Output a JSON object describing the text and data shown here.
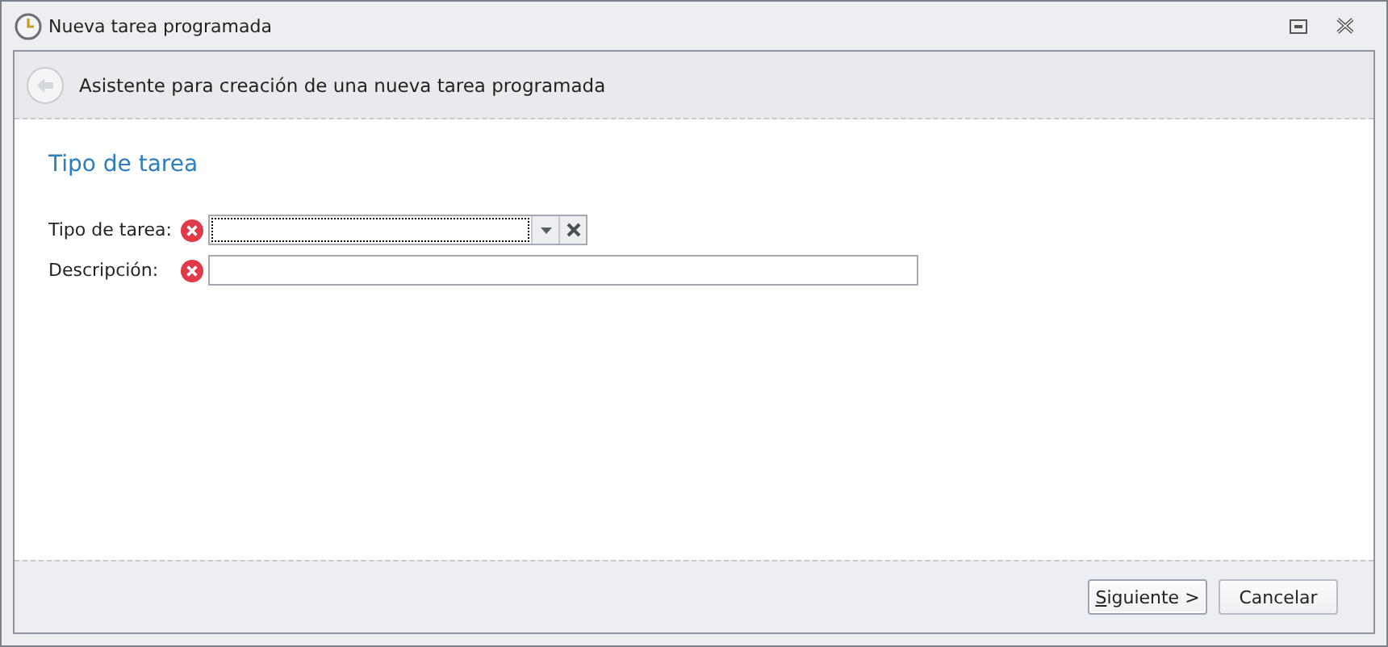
{
  "window": {
    "title": "Nueva tarea programada"
  },
  "header": {
    "text": "Asistente para creación de una nueva tarea programada"
  },
  "section_title": "Tipo de tarea",
  "fields": [
    {
      "kind": "combo",
      "label": "Tipo de tarea:",
      "error": true,
      "focused": true
    },
    {
      "kind": "text",
      "label": "Descripción:",
      "error": true,
      "focused": false
    }
  ],
  "buttons": [
    {
      "label": "Siguiente >",
      "default": true
    },
    {
      "label": "Cancelar",
      "default": false
    }
  ]
}
